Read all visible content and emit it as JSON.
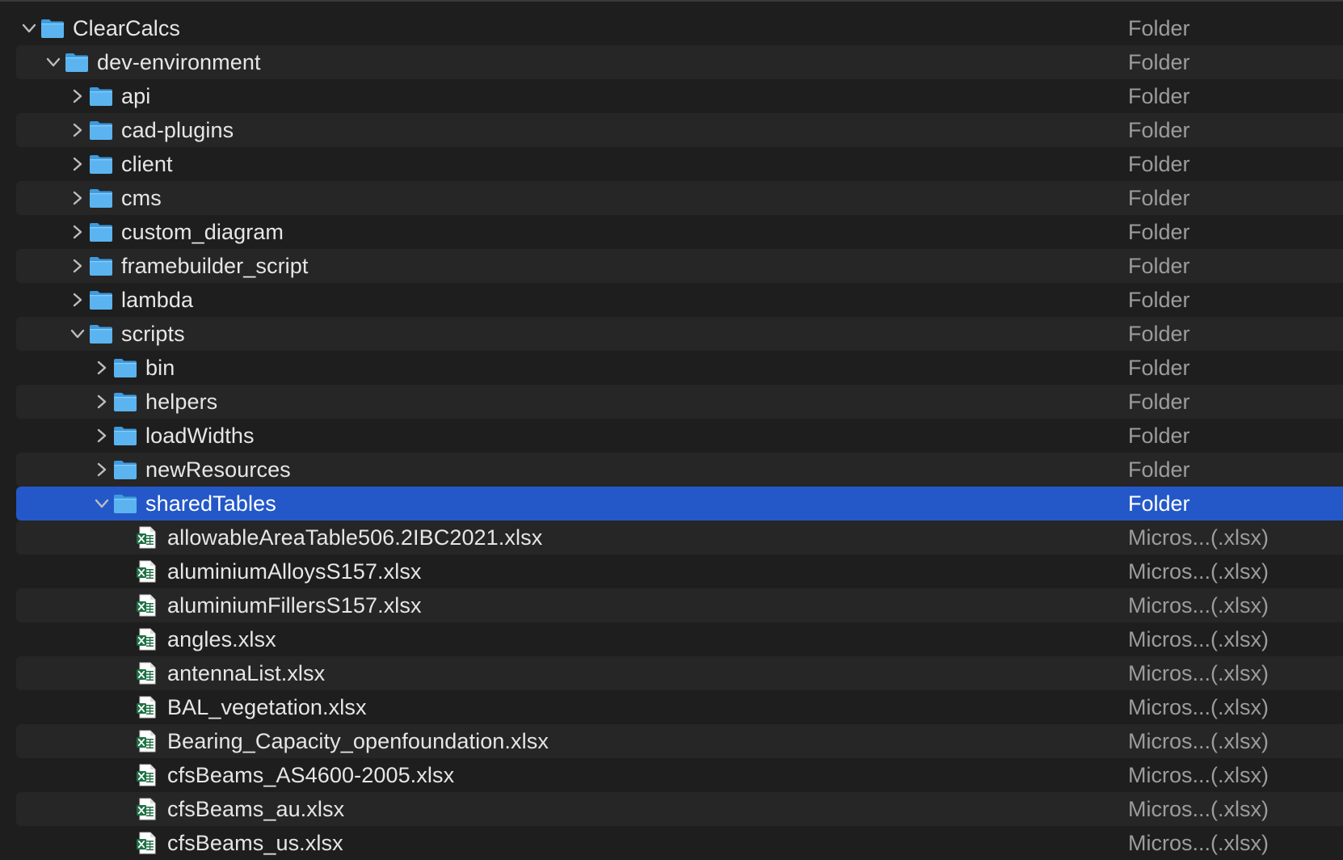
{
  "colors": {
    "background": "#1e1e1e",
    "row_alt": "#262626",
    "selection": "#2458c9",
    "folder_blue": "#5bb4f0",
    "excel_green": "#1e7145"
  },
  "rows": [
    {
      "name": "ClearCalcs",
      "kind": "Folder",
      "type": "folder",
      "depth": 0,
      "disclosure": "expanded",
      "selected": false
    },
    {
      "name": "dev-environment",
      "kind": "Folder",
      "type": "folder",
      "depth": 1,
      "disclosure": "expanded",
      "selected": false
    },
    {
      "name": "api",
      "kind": "Folder",
      "type": "folder",
      "depth": 2,
      "disclosure": "collapsed",
      "selected": false
    },
    {
      "name": "cad-plugins",
      "kind": "Folder",
      "type": "folder",
      "depth": 2,
      "disclosure": "collapsed",
      "selected": false
    },
    {
      "name": "client",
      "kind": "Folder",
      "type": "folder",
      "depth": 2,
      "disclosure": "collapsed",
      "selected": false
    },
    {
      "name": "cms",
      "kind": "Folder",
      "type": "folder",
      "depth": 2,
      "disclosure": "collapsed",
      "selected": false
    },
    {
      "name": "custom_diagram",
      "kind": "Folder",
      "type": "folder",
      "depth": 2,
      "disclosure": "collapsed",
      "selected": false
    },
    {
      "name": "framebuilder_script",
      "kind": "Folder",
      "type": "folder",
      "depth": 2,
      "disclosure": "collapsed",
      "selected": false
    },
    {
      "name": "lambda",
      "kind": "Folder",
      "type": "folder",
      "depth": 2,
      "disclosure": "collapsed",
      "selected": false
    },
    {
      "name": "scripts",
      "kind": "Folder",
      "type": "folder",
      "depth": 2,
      "disclosure": "expanded",
      "selected": false
    },
    {
      "name": "bin",
      "kind": "Folder",
      "type": "folder",
      "depth": 3,
      "disclosure": "collapsed",
      "selected": false
    },
    {
      "name": "helpers",
      "kind": "Folder",
      "type": "folder",
      "depth": 3,
      "disclosure": "collapsed",
      "selected": false
    },
    {
      "name": "loadWidths",
      "kind": "Folder",
      "type": "folder",
      "depth": 3,
      "disclosure": "collapsed",
      "selected": false
    },
    {
      "name": "newResources",
      "kind": "Folder",
      "type": "folder",
      "depth": 3,
      "disclosure": "collapsed",
      "selected": false
    },
    {
      "name": "sharedTables",
      "kind": "Folder",
      "type": "folder",
      "depth": 3,
      "disclosure": "expanded",
      "selected": true
    },
    {
      "name": "allowableAreaTable506.2IBC2021.xlsx",
      "kind": "Micros...(.xlsx)",
      "type": "xlsx",
      "depth": 4,
      "disclosure": "none",
      "selected": false
    },
    {
      "name": "aluminiumAlloysS157.xlsx",
      "kind": "Micros...(.xlsx)",
      "type": "xlsx",
      "depth": 4,
      "disclosure": "none",
      "selected": false
    },
    {
      "name": "aluminiumFillersS157.xlsx",
      "kind": "Micros...(.xlsx)",
      "type": "xlsx",
      "depth": 4,
      "disclosure": "none",
      "selected": false
    },
    {
      "name": "angles.xlsx",
      "kind": "Micros...(.xlsx)",
      "type": "xlsx",
      "depth": 4,
      "disclosure": "none",
      "selected": false
    },
    {
      "name": "antennaList.xlsx",
      "kind": "Micros...(.xlsx)",
      "type": "xlsx",
      "depth": 4,
      "disclosure": "none",
      "selected": false
    },
    {
      "name": "BAL_vegetation.xlsx",
      "kind": "Micros...(.xlsx)",
      "type": "xlsx",
      "depth": 4,
      "disclosure": "none",
      "selected": false
    },
    {
      "name": "Bearing_Capacity_openfoundation.xlsx",
      "kind": "Micros...(.xlsx)",
      "type": "xlsx",
      "depth": 4,
      "disclosure": "none",
      "selected": false
    },
    {
      "name": "cfsBeams_AS4600-2005.xlsx",
      "kind": "Micros...(.xlsx)",
      "type": "xlsx",
      "depth": 4,
      "disclosure": "none",
      "selected": false
    },
    {
      "name": "cfsBeams_au.xlsx",
      "kind": "Micros...(.xlsx)",
      "type": "xlsx",
      "depth": 4,
      "disclosure": "none",
      "selected": false
    },
    {
      "name": "cfsBeams_us.xlsx",
      "kind": "Micros...(.xlsx)",
      "type": "xlsx",
      "depth": 4,
      "disclosure": "none",
      "selected": false
    }
  ]
}
